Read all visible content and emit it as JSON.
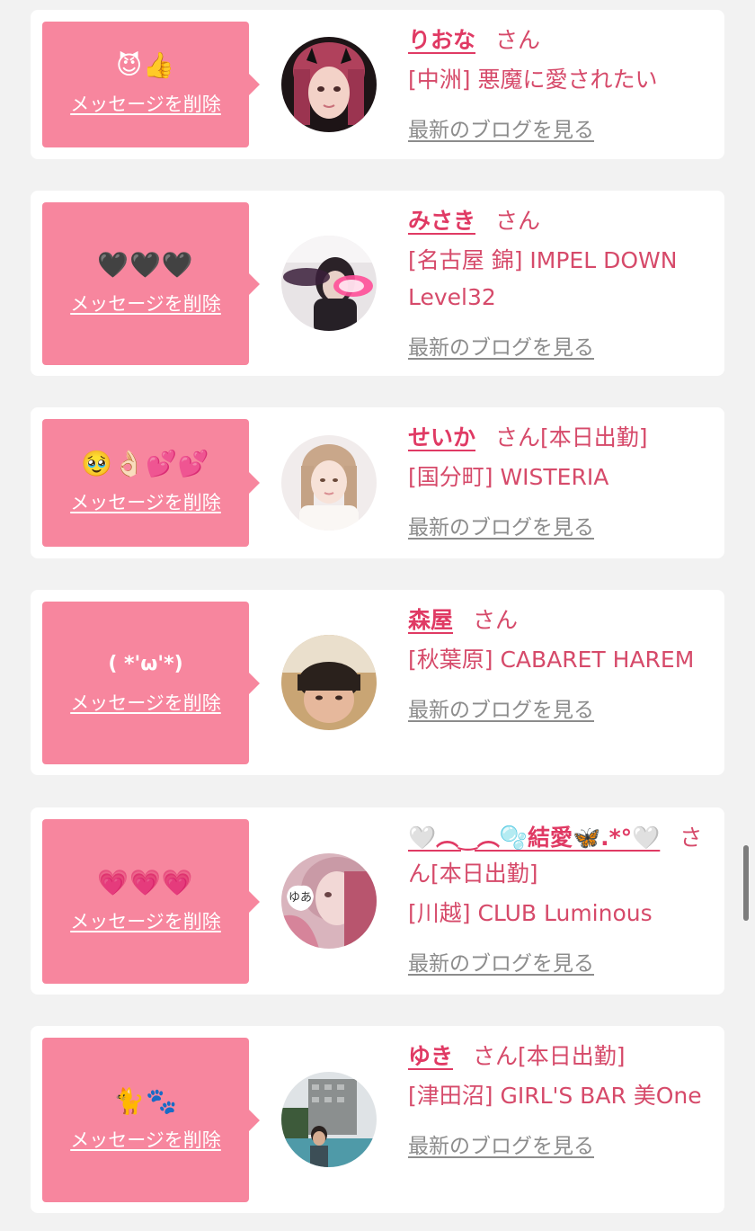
{
  "delete_label": "メッセージを削除",
  "blog_label": "最新のブログを見る",
  "san_label": "さん",
  "colors": {
    "accent": "#f7869e",
    "name": "#e03a64",
    "text": "#d64a6a",
    "link": "#8c8c8c"
  },
  "entries": [
    {
      "message": "😈👍",
      "name": "りおな",
      "status": "",
      "shop": "[中洲] 悪魔に愛されたい"
    },
    {
      "message": "🖤🖤🖤",
      "name": "みさき",
      "status": "",
      "shop": "[名古屋 錦] IMPEL DOWN Level32"
    },
    {
      "message": "🥹👌🏻💕💕",
      "name": "せいか",
      "status": "[本日出勤]",
      "shop": "[国分町] WISTERIA"
    },
    {
      "message": "( *'ω'*)",
      "name": "森屋",
      "status": "",
      "shop": "[秋葉原] CABARET HAREM"
    },
    {
      "message": "💗💗💗",
      "name": "🤍︵‿︵🫧結愛🦋.*°🤍",
      "status": "[本日出勤]",
      "shop": "[川越] CLUB Luminous"
    },
    {
      "message": "🐈🐾",
      "name": "ゆき",
      "status": "[本日出勤]",
      "shop": "[津田沼] GIRL'S BAR 美One"
    }
  ]
}
